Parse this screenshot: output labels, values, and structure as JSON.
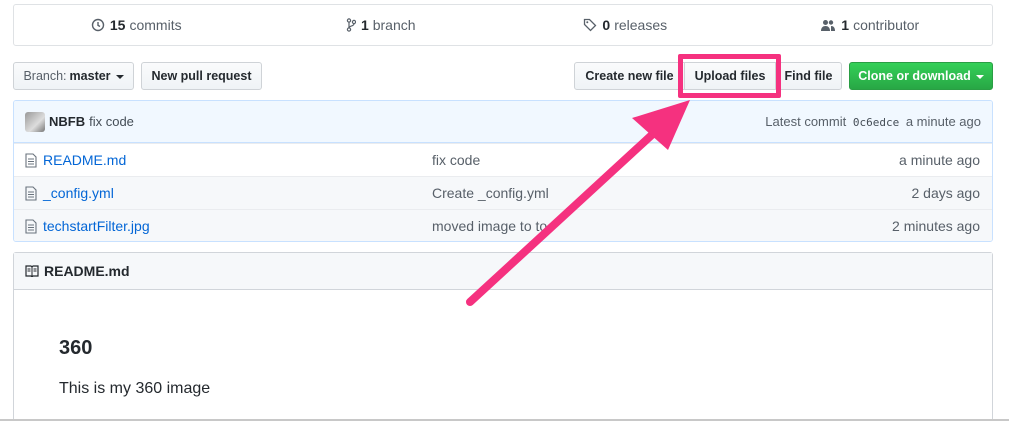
{
  "summary": {
    "commits_count": "15",
    "commits_label": "commits",
    "branch_count": "1",
    "branch_label": "branch",
    "releases_count": "0",
    "releases_label": "releases",
    "contributor_count": "1",
    "contributor_label": "contributor"
  },
  "toolbar": {
    "branch_prefix": "Branch:",
    "branch_name": "master",
    "new_pull_request": "New pull request",
    "create_new_file": "Create new file",
    "upload_files": "Upload files",
    "find_file": "Find file",
    "clone_or_download": "Clone or download"
  },
  "commit": {
    "author": "NBFB",
    "message": "fix code",
    "latest_prefix": "Latest commit",
    "sha": "0c6edce",
    "age": "a minute ago"
  },
  "files": [
    {
      "name": "README.md",
      "message": "fix code",
      "age": "a minute ago"
    },
    {
      "name": "_config.yml",
      "message": "Create _config.yml",
      "age": "2 days ago"
    },
    {
      "name": "techstartFilter.jpg",
      "message": "moved image to to",
      "age": "2 minutes ago"
    }
  ],
  "readme": {
    "header": "README.md",
    "heading": "360",
    "body": "This is my 360 image"
  },
  "colors": {
    "highlight": "#f5317f",
    "link": "#0366d6",
    "green_button": "#28a745"
  },
  "icons": [
    "history-icon",
    "branch-icon",
    "tag-icon",
    "people-icon",
    "file-icon",
    "book-icon"
  ]
}
